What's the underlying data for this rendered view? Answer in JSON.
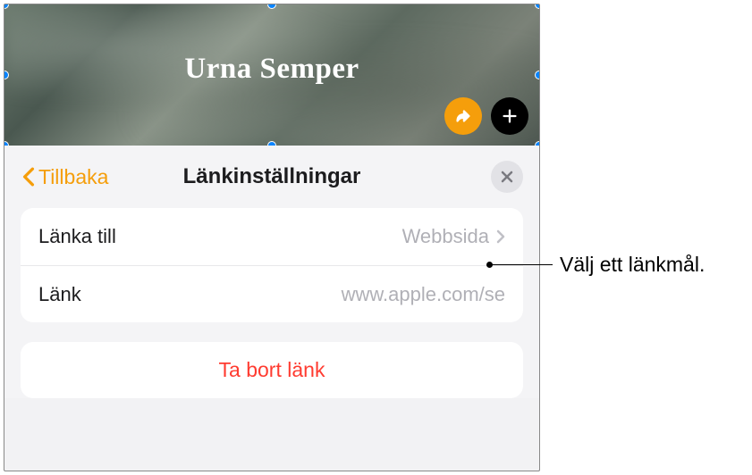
{
  "banner": {
    "title": "Urna Semper"
  },
  "panel": {
    "back_label": "Tillbaka",
    "title": "Länkinställningar"
  },
  "rows": {
    "link_to": {
      "label": "Länka till",
      "value": "Webbsida"
    },
    "link": {
      "label": "Länk",
      "value": "www.apple.com/se"
    }
  },
  "actions": {
    "remove_label": "Ta bort länk"
  },
  "callout": {
    "text": "Välj ett länkmål."
  }
}
